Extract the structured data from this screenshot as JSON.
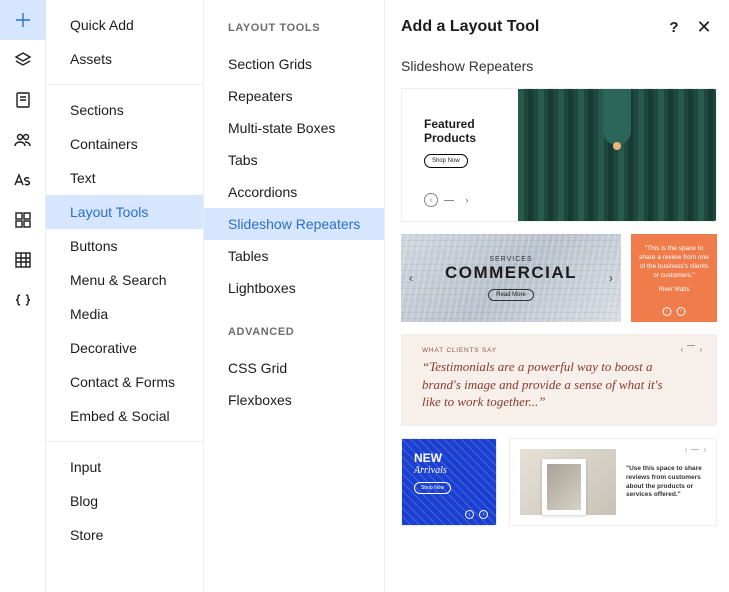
{
  "rail": {
    "items": [
      "add",
      "layers",
      "page",
      "users",
      "typography",
      "grid",
      "table",
      "code"
    ],
    "active": "add"
  },
  "categories": {
    "groups": [
      [
        "Quick Add",
        "Assets"
      ],
      [
        "Sections",
        "Containers",
        "Text",
        "Layout Tools",
        "Buttons",
        "Menu & Search",
        "Media",
        "Decorative",
        "Contact & Forms",
        "Embed & Social"
      ],
      [
        "Input",
        "Blog",
        "Store"
      ]
    ],
    "active": "Layout Tools"
  },
  "tools": {
    "heading_layout": "LAYOUT TOOLS",
    "layout_items": [
      "Section Grids",
      "Repeaters",
      "Multi-state Boxes",
      "Tabs",
      "Accordions",
      "Slideshow Repeaters",
      "Tables",
      "Lightboxes"
    ],
    "active": "Slideshow Repeaters",
    "heading_advanced": "ADVANCED",
    "advanced_items": [
      "CSS Grid",
      "Flexboxes"
    ]
  },
  "preview": {
    "title": "Add a Layout Tool",
    "help_label": "?",
    "subtitle": "Slideshow Repeaters",
    "card1": {
      "heading_line1": "Featured",
      "heading_line2": "Products",
      "button": "Shop Now"
    },
    "card2": {
      "kicker": "SERVICES",
      "title": "COMMERCIAL",
      "button": "Read More",
      "review": "\"This is the space to share a review from one of the business's clients or customers.\"",
      "reviewer": "River Watts"
    },
    "card3": {
      "kicker": "WHAT CLIENTS SAY",
      "quote": "“Testimonials are a powerful way to boost a brand's image and provide a sense of what it's like to work together...”"
    },
    "card4": {
      "line1": "NEW",
      "line2": "Arrivals",
      "button": "Shop Now"
    },
    "card5": {
      "text": "\"Use this space to share reviews from customers about the products or services offered.\""
    }
  }
}
